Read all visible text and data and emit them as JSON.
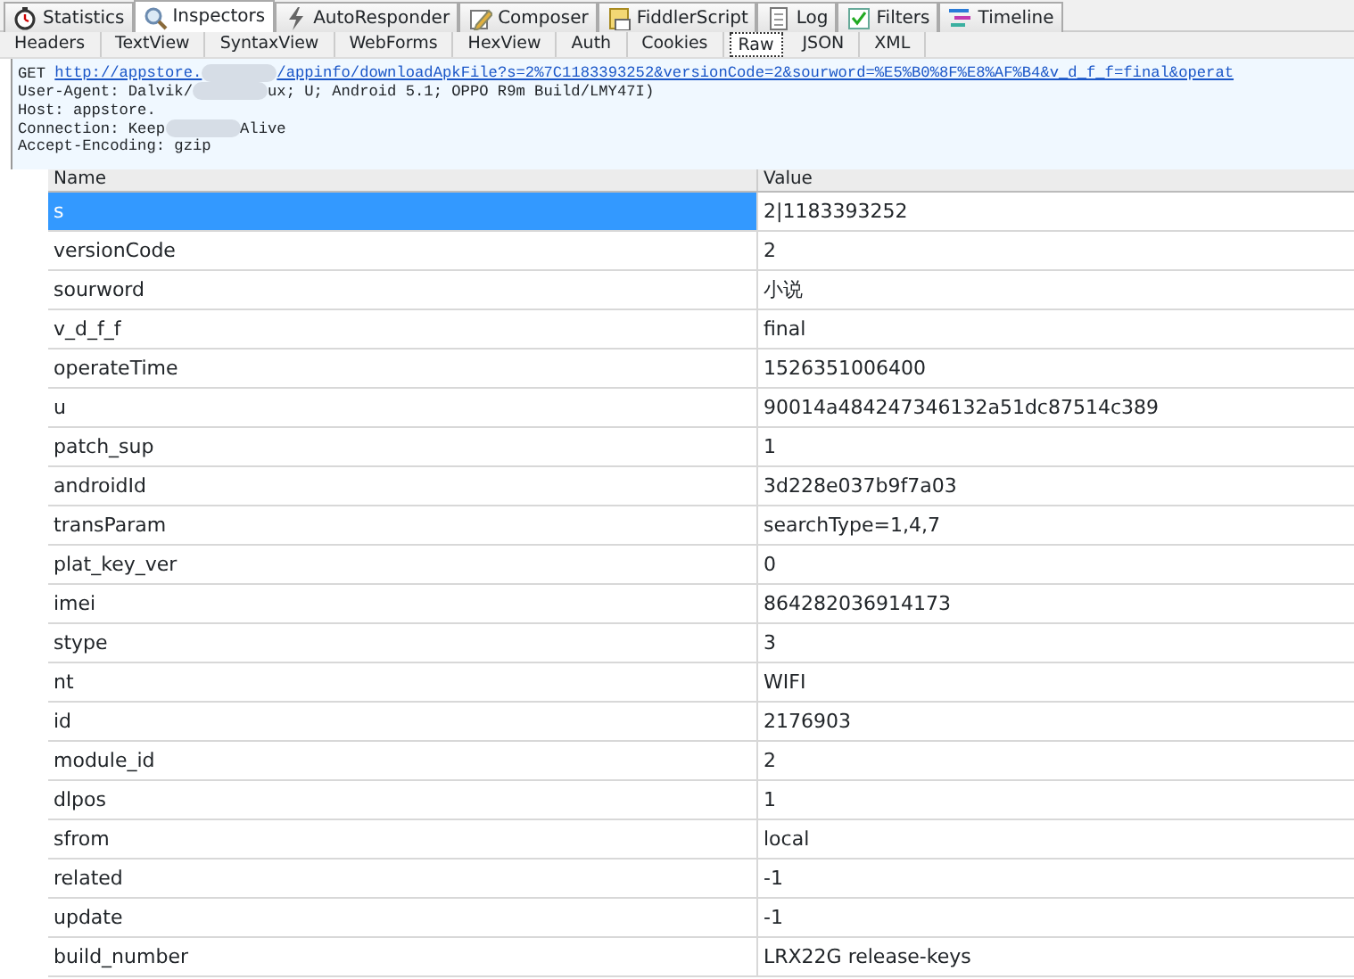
{
  "tabs": [
    {
      "label": "Statistics",
      "selected": false
    },
    {
      "label": "Inspectors",
      "selected": true
    },
    {
      "label": "AutoResponder",
      "selected": false
    },
    {
      "label": "Composer",
      "selected": false
    },
    {
      "label": "FiddlerScript",
      "selected": false
    },
    {
      "label": "Log",
      "selected": false
    },
    {
      "label": "Filters",
      "selected": false
    },
    {
      "label": "Timeline",
      "selected": false
    }
  ],
  "subtabs": [
    {
      "label": "Headers",
      "selected": false
    },
    {
      "label": "TextView",
      "selected": false
    },
    {
      "label": "SyntaxView",
      "selected": false
    },
    {
      "label": "WebForms",
      "selected": false
    },
    {
      "label": "HexView",
      "selected": false
    },
    {
      "label": "Auth",
      "selected": false
    },
    {
      "label": "Cookies",
      "selected": false
    },
    {
      "label": "Raw",
      "selected": true
    },
    {
      "label": "JSON",
      "selected": false
    },
    {
      "label": "XML",
      "selected": false
    }
  ],
  "raw_lines": [
    {
      "parts": [
        "GET"
      ],
      "link": [
        "http://appstore.",
        "/appinfo/downloadApkFile?s=2%7C1183393252&versionCode=2&sourword=%E5%B0%8F%E8%AF%B4&v_d_f_f=final&operat"
      ]
    },
    {
      "parts": [
        "User-Agent: Dalvik/",
        "ux; U; Android 5.1; OPPO R9m Build/LMY47I)"
      ]
    },
    {
      "parts": [
        "Host: appstore."
      ]
    },
    {
      "parts": [
        "Connection: Keep",
        "Alive"
      ]
    },
    {
      "parts": [
        "Accept-Encoding: gzip"
      ]
    }
  ],
  "table": {
    "columns": [
      "Name",
      "Value"
    ],
    "rows": [
      {
        "name": "s",
        "value": "2|1183393252",
        "selected": true
      },
      {
        "name": "versionCode",
        "value": "2",
        "selected": false
      },
      {
        "name": "sourword",
        "value": "小说",
        "selected": false
      },
      {
        "name": "v_d_f_f",
        "value": "final",
        "selected": false
      },
      {
        "name": "operateTime",
        "value": "1526351006400",
        "selected": false
      },
      {
        "name": "u",
        "value": "90014a484247346132a51dc87514c389",
        "selected": false
      },
      {
        "name": "patch_sup",
        "value": "1",
        "selected": false
      },
      {
        "name": "androidId",
        "value": "3d228e037b9f7a03",
        "selected": false
      },
      {
        "name": "transParam",
        "value": "searchType=1,4,7",
        "selected": false
      },
      {
        "name": "plat_key_ver",
        "value": "0",
        "selected": false
      },
      {
        "name": "imei",
        "value": "864282036914173",
        "selected": false
      },
      {
        "name": "stype",
        "value": "3",
        "selected": false
      },
      {
        "name": "nt",
        "value": "WIFI",
        "selected": false
      },
      {
        "name": "id",
        "value": "2176903",
        "selected": false
      },
      {
        "name": "module_id",
        "value": "2",
        "selected": false
      },
      {
        "name": "dlpos",
        "value": "1",
        "selected": false
      },
      {
        "name": "sfrom",
        "value": "local",
        "selected": false
      },
      {
        "name": "related",
        "value": "-1",
        "selected": false
      },
      {
        "name": "update",
        "value": "-1",
        "selected": false
      },
      {
        "name": "build_number",
        "value": "LRX22G release-keys",
        "selected": false
      }
    ]
  }
}
